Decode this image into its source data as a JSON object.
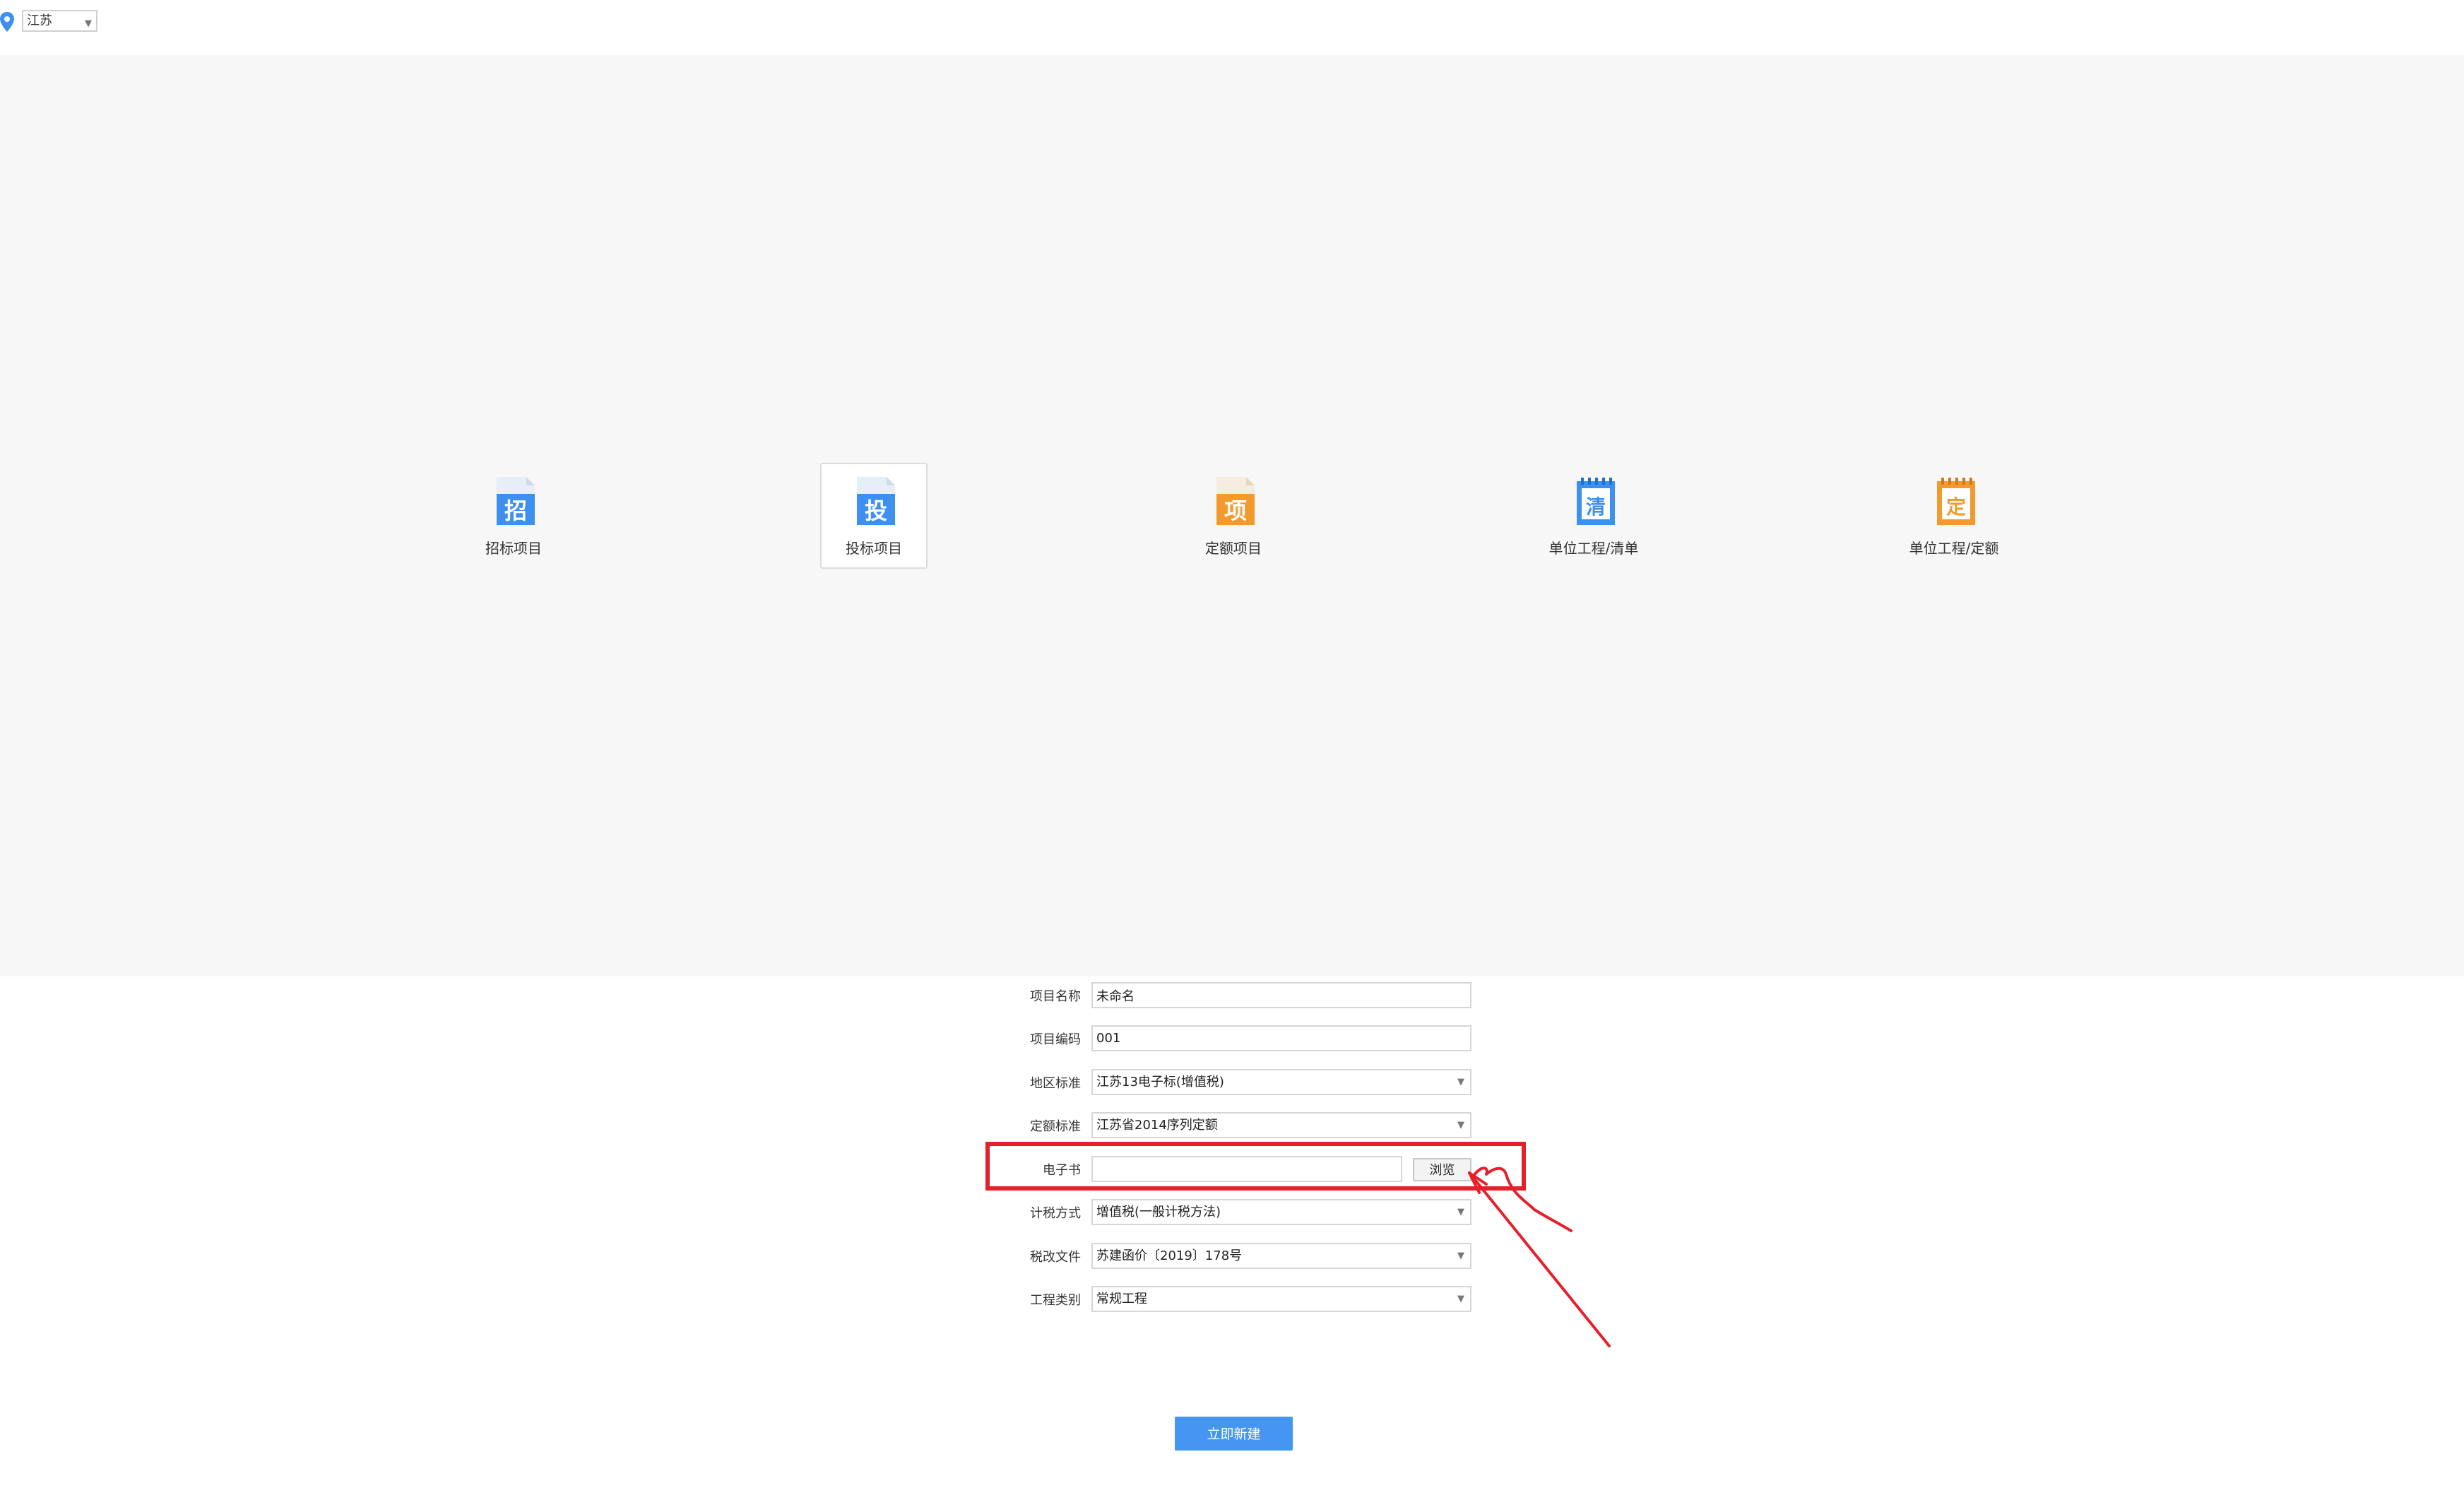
{
  "topbar": {
    "region": "江苏"
  },
  "project_types": [
    {
      "label": "招标项目",
      "glyph": "招",
      "icon": "zhao-doc-icon",
      "color": "#3d8ff0"
    },
    {
      "label": "投标项目",
      "glyph": "投",
      "icon": "tou-doc-icon",
      "color": "#3d8ff0"
    },
    {
      "label": "定额项目",
      "glyph": "项",
      "icon": "xiang-doc-icon",
      "color": "#f29a2e"
    },
    {
      "label": "单位工程/清单",
      "glyph": "清",
      "icon": "qing-notepad-icon",
      "color": "#3d8ff0"
    },
    {
      "label": "单位工程/定额",
      "glyph": "定",
      "icon": "ding-notepad-icon",
      "color": "#f29a2e"
    }
  ],
  "form": {
    "project_name": {
      "label": "项目名称",
      "value": "未命名"
    },
    "project_code": {
      "label": "项目编码",
      "value": "001"
    },
    "region_standard": {
      "label": "地区标准",
      "value": "江苏13电子标(增值税)"
    },
    "quota_standard": {
      "label": "定额标准",
      "value": "江苏省2014序列定额"
    },
    "ebook": {
      "label": "电子书",
      "value": "",
      "browse": "浏览"
    },
    "tax_method": {
      "label": "计税方式",
      "value": "增值税(一般计税方法)"
    },
    "tax_reform_file": {
      "label": "税改文件",
      "value": "苏建函价〔2019〕178号"
    },
    "project_category": {
      "label": "工程类别",
      "value": "常规工程"
    }
  },
  "create_button": "立即新建",
  "colors": {
    "accent": "#4596f2",
    "highlight": "#e5202a",
    "panel": "#f7f7f7"
  }
}
